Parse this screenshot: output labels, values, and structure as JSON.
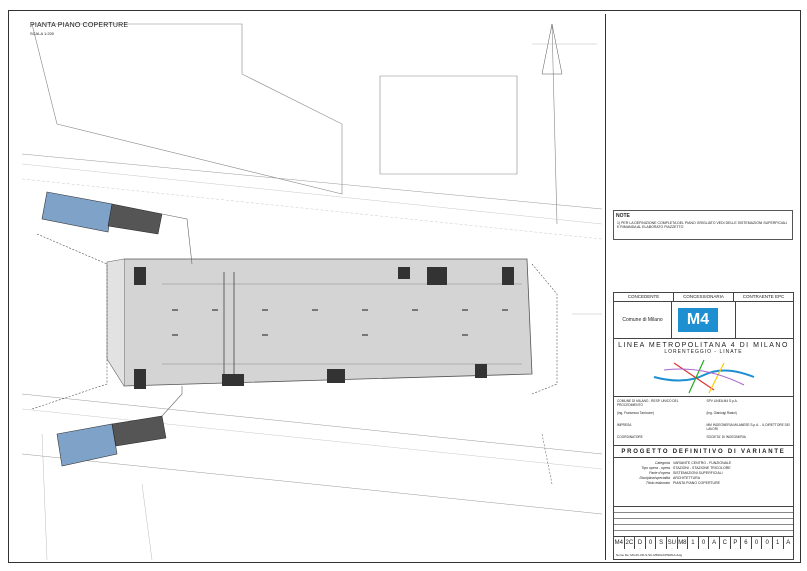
{
  "sheet": {
    "title": "PIANTA PIANO COPERTURE",
    "scale": "SCALA 1:200"
  },
  "note": {
    "heading": "NOTE",
    "text": "1) PER LA DEFINIZIONE COMPLETA DEL PIANO GRIGLIATO VEDI DELLE SISTEMAZIONI SUPERFICIALI E RIMANDA AL ELABORATO PIAZZETTO"
  },
  "title_block": {
    "header": [
      "CONCEDENTE",
      "CONCESSIONARIA",
      "CONTRAENTE EPC"
    ],
    "concedente_logo_text": "Comune di Milano",
    "concessionaria_logo": "M4",
    "line_title": "LINEA METROPOLITANA 4 DI MILANO",
    "line_subtitle": "LORENTEGGIO - LINATE",
    "parties": [
      "COMUNE DI MILANO - RESP. UNICO DEL PROCEDIMENTO",
      "SPV LINEA M4 S.p.A.",
      "(ing. Francesco Tarricone)",
      "(ing. Gianluigi Rasini)",
      "IMPRESA",
      "MM INGEGNERIA MILANESE S.p.A. - IL DIRETTORE DEI LAVORI",
      "COORDINATORE",
      "SOCIETA' DI INGEGNERIA"
    ],
    "project_heading": "PROGETTO DEFINITIVO DI VARIANTE",
    "meta": [
      {
        "k": "Categoria",
        "v": "VARIANTE CENTRO - FUNZIONALE"
      },
      {
        "k": "Tipo opera - opera",
        "v": "STAZIONI - STAZIONE TRICOLORE"
      },
      {
        "k": "Parte d'opera",
        "v": "SISTEMAZIONI SUPERFICIALI"
      },
      {
        "k": "Disciplina/specialità",
        "v": "ARCHITETTURA"
      },
      {
        "k": "Titolo elaborato",
        "v": "PIANTA PIANO COPERTURE"
      }
    ],
    "code": [
      "M4",
      "2C",
      "D",
      "0",
      "S",
      "SU",
      "M8",
      "1",
      "0",
      "A",
      "C",
      "P",
      "6",
      "0",
      "0",
      "1",
      "A"
    ],
    "footer": "Nome file: M4-2C-D0-S-SU-M810ACP6001A.dwg"
  },
  "colors": {
    "station": "#d4d4d4",
    "stairs": "#7ea2c8",
    "metro_line": "#1e8fd0"
  }
}
